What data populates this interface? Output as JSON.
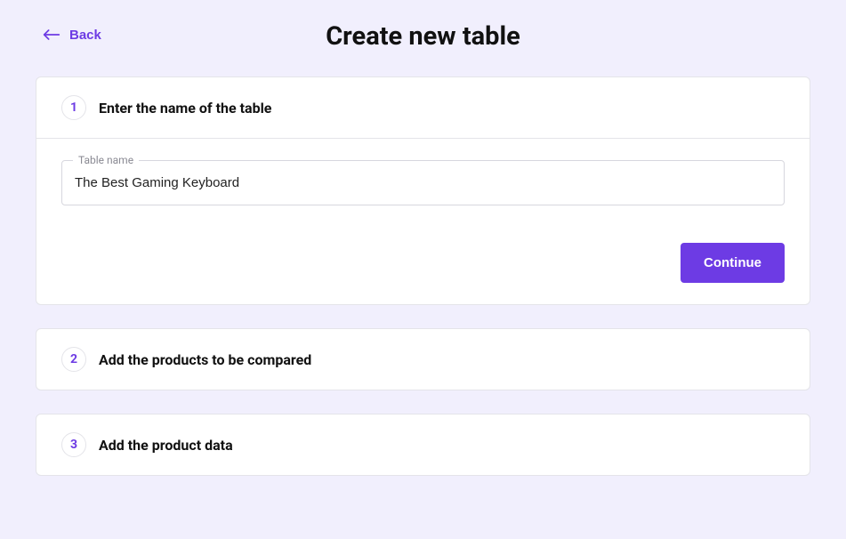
{
  "header": {
    "back_label": "Back",
    "title": "Create new table"
  },
  "steps": [
    {
      "number": "1",
      "title": "Enter the name of the table",
      "field_label": "Table name",
      "field_value": "The Best Gaming Keyboard",
      "continue_label": "Continue"
    },
    {
      "number": "2",
      "title": "Add the products to be compared"
    },
    {
      "number": "3",
      "title": "Add the product data"
    }
  ]
}
